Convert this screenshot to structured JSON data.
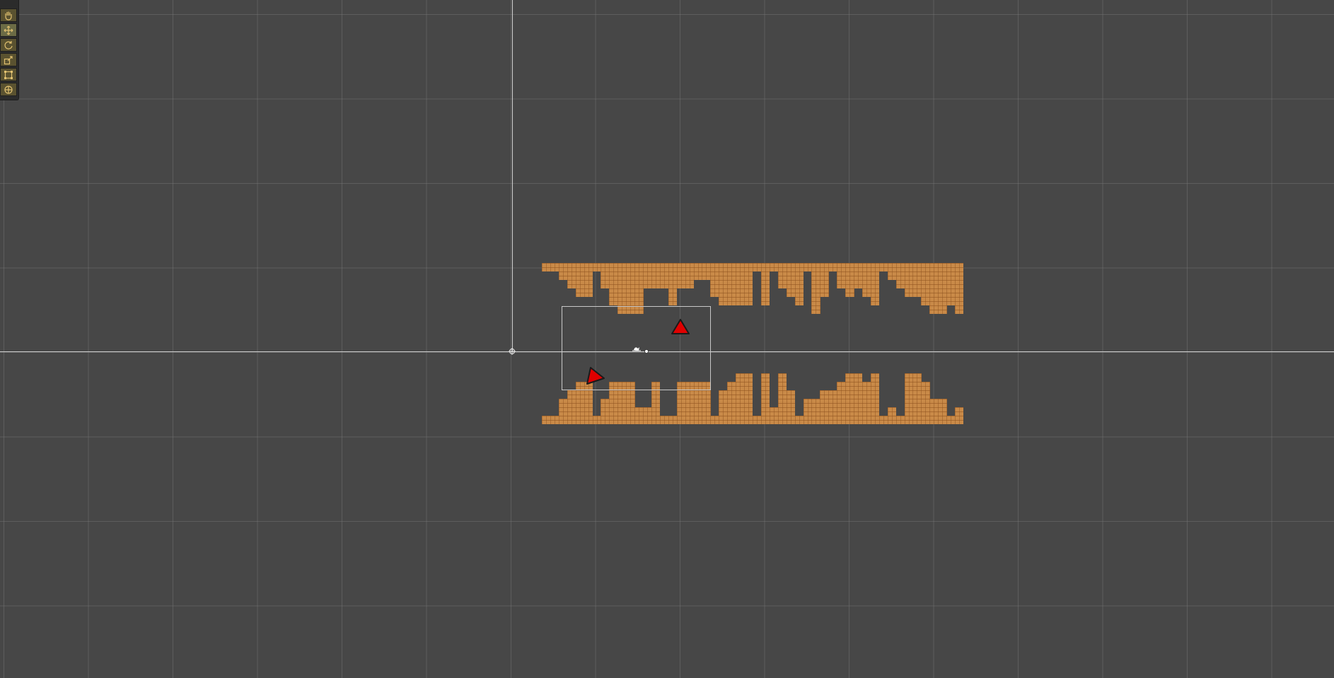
{
  "scene_view": {
    "background_color": "#474747",
    "grid_color": "#5a5a5a",
    "axis_color": "#d0d0d0",
    "tile_color": "#c98a48",
    "marker_color": "#e00000"
  },
  "toolbar": {
    "tools": [
      {
        "name": "hand-tool",
        "icon": "hand-icon",
        "active": false
      },
      {
        "name": "move-tool",
        "icon": "move-arrows-icon",
        "active": true
      },
      {
        "name": "rotate-tool",
        "icon": "rotate-icon",
        "active": false
      },
      {
        "name": "scale-tool",
        "icon": "scale-icon",
        "active": false
      },
      {
        "name": "rect-tool",
        "icon": "rect-transform-icon",
        "active": false
      },
      {
        "name": "transform-tool",
        "icon": "combined-transform-icon",
        "active": false
      }
    ]
  },
  "tilemap": {
    "columns": 50,
    "top_ceiling_depths": [
      1,
      1,
      2,
      3,
      4,
      4,
      1,
      3,
      5,
      6,
      6,
      6,
      3,
      3,
      3,
      5,
      3,
      3,
      2,
      2,
      4,
      5,
      5,
      5,
      5,
      1,
      5,
      1,
      3,
      4,
      5,
      1,
      6,
      4,
      1,
      3,
      4,
      3,
      4,
      5,
      1,
      2,
      3,
      4,
      4,
      5,
      6,
      6,
      5,
      6
    ],
    "bottom_floor_heights": [
      1,
      1,
      3,
      4,
      5,
      5,
      1,
      3,
      5,
      5,
      5,
      2,
      2,
      5,
      1,
      1,
      5,
      5,
      5,
      5,
      1,
      4,
      5,
      6,
      6,
      1,
      6,
      2,
      6,
      4,
      1,
      3,
      3,
      4,
      4,
      5,
      6,
      6,
      5,
      6,
      1,
      2,
      1,
      6,
      6,
      5,
      3,
      3,
      1,
      2
    ]
  },
  "markers": [
    {
      "name": "player-marker-upright",
      "shape": "triangle-up"
    },
    {
      "name": "player-marker-tilted",
      "shape": "triangle-tilted"
    }
  ]
}
